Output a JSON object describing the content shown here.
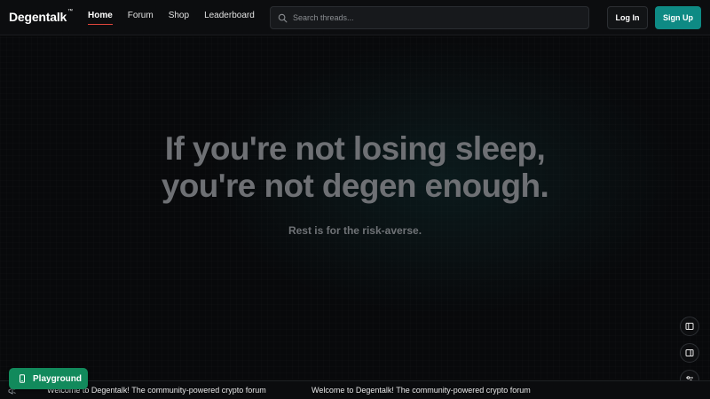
{
  "header": {
    "logo": "Degentalk",
    "logo_mark": "™",
    "nav": [
      {
        "label": "Home",
        "active": true
      },
      {
        "label": "Forum",
        "active": false
      },
      {
        "label": "Shop",
        "active": false
      },
      {
        "label": "Leaderboard",
        "active": false
      }
    ],
    "search_placeholder": "Search threads...",
    "login_label": "Log In",
    "signup_label": "Sign Up"
  },
  "hero": {
    "headline_line1": "If you're not losing sleep,",
    "headline_line2": "you're not degen enough.",
    "subline": "Rest is for the risk-averse."
  },
  "side_tools": [
    {
      "icon": "sidebar-left-icon"
    },
    {
      "icon": "sidebar-right-icon"
    },
    {
      "icon": "sliders-icon"
    }
  ],
  "ticker": {
    "messages": [
      "Welcome to Degentalk! The community-powered crypto forum",
      "Welcome to Degentalk! The community-powered crypto forum"
    ]
  },
  "playground": {
    "label": "Playground",
    "icon": "phone-icon"
  },
  "colors": {
    "accent_teal": "#0e8a84",
    "playground_green": "#128a5c",
    "active_underline": "#e0463c"
  }
}
